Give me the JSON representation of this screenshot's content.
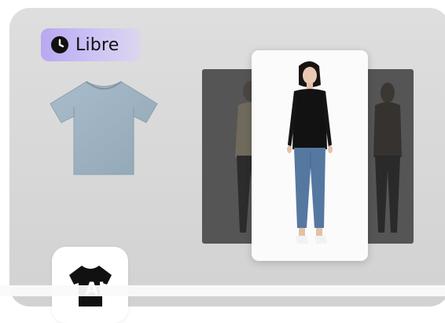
{
  "badge": {
    "label": "Libre",
    "icon": "clock-icon"
  },
  "garment": {
    "icon": "tshirt-icon",
    "color": "#9fb3c0"
  },
  "preview": {
    "background_color": "#555555",
    "model": {
      "top_color": "#121212",
      "jeans_color": "#5578a0"
    }
  },
  "app_icon": {
    "icon": "tshirt-ai-icon",
    "text": "AI"
  },
  "colors": {
    "card": "#d6d6d6",
    "badge_start": "#b8a8f2",
    "badge_end": "#dcd6ee"
  }
}
